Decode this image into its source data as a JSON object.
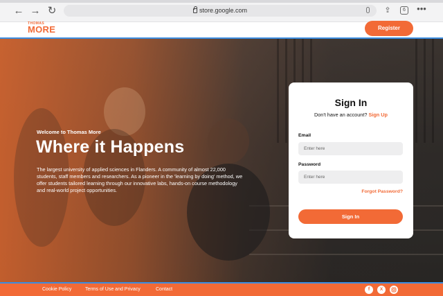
{
  "browser": {
    "url": "store.google.com",
    "tabs_count": "6"
  },
  "header": {
    "logo_top": "THOMAS",
    "logo_main": "MORE",
    "register_label": "Register"
  },
  "hero": {
    "welcome": "Welcome to Thomas More",
    "title": "Where it Happens",
    "description": "The largest university of applied sciences in Flanders. A community of almost 22,000 students, staff members and researchers. As a pioneer in the 'learning by doing' method, we offer students tailored learning through our innovative labs, hands-on course methodology and real-world project opportunities."
  },
  "signin": {
    "title": "Sign In",
    "no_account": "Don't have an account?",
    "signup_link": "Sign Up",
    "email_label": "Email",
    "email_placeholder": "Enter here",
    "password_label": "Password",
    "password_placeholder": "Enter here",
    "forgot": "Forgot Password?",
    "submit": "Sign In"
  },
  "footer": {
    "links": [
      "Cookie Policy",
      "Terms of Use and Privacy",
      "Contact"
    ],
    "social": [
      "facebook-icon",
      "x-icon",
      "instagram-icon"
    ]
  },
  "colors": {
    "accent": "#f26a36",
    "header_line": "#3c8de0"
  }
}
